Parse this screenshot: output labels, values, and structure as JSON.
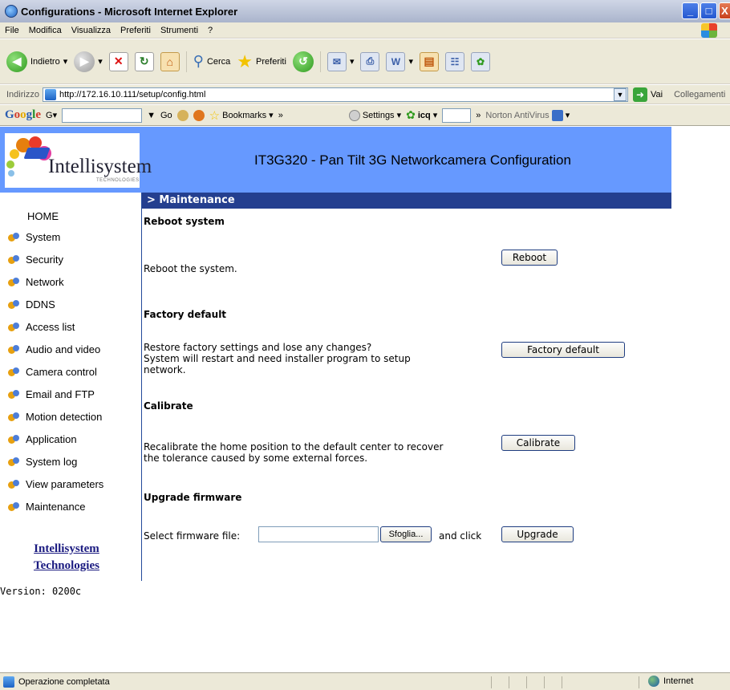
{
  "window": {
    "title": "Configurations - Microsoft Internet Explorer",
    "buttons": [
      "_",
      "□",
      "X"
    ]
  },
  "menu": [
    "File",
    "Modifica",
    "Visualizza",
    "Preferiti",
    "Strumenti",
    "?"
  ],
  "toolbar": {
    "back": "Indietro",
    "search": "Cerca",
    "favorites": "Preferiti"
  },
  "address": {
    "label": "Indirizzo",
    "url": "http://172.16.10.111/setup/config.html",
    "go": "Vai",
    "links": "Collegamenti"
  },
  "googlebar": {
    "go": "Go",
    "bookmarks": "Bookmarks",
    "settings": "Settings",
    "icq": "icq",
    "antivirus": "Norton AntiVirus"
  },
  "header": {
    "logo": "Intellisystem",
    "logo_sub": "TECHNOLOGIES",
    "title": "IT3G320 - Pan Tilt 3G Networkcamera Configuration"
  },
  "sidebar": {
    "home": "HOME",
    "items": [
      "System",
      "Security",
      "Network",
      "DDNS",
      "Access list",
      "Audio and video",
      "Camera control",
      "Email and FTP",
      "Motion detection",
      "Application",
      "System log",
      "View parameters",
      "Maintenance"
    ],
    "company_line1": "Intellisystem",
    "company_line2": "Technologies"
  },
  "version": "Version: 0200c",
  "content": {
    "breadcrumb": "> Maintenance",
    "reboot": {
      "title": "Reboot system",
      "text": "Reboot the system.",
      "button": "Reboot"
    },
    "factory": {
      "title": "Factory default",
      "text1": "Restore factory settings and lose any changes?",
      "text2": "System will restart and need installer program to setup",
      "text3": "network.",
      "button": "Factory default"
    },
    "calibrate": {
      "title": "Calibrate",
      "text1": "Recalibrate the home position to the default center to recover",
      "text2": "the tolerance caused by some external forces.",
      "button": "Calibrate"
    },
    "upgrade": {
      "title": "Upgrade firmware",
      "label": "Select firmware file:",
      "browse": "Sfoglia...",
      "and_click": "and click",
      "button": "Upgrade"
    }
  },
  "status": {
    "text": "Operazione completata",
    "zone": "Internet"
  },
  "colors": {
    "header_bg": "#6699ff",
    "section_bar": "#243f8f",
    "link": "#1a1a80"
  }
}
